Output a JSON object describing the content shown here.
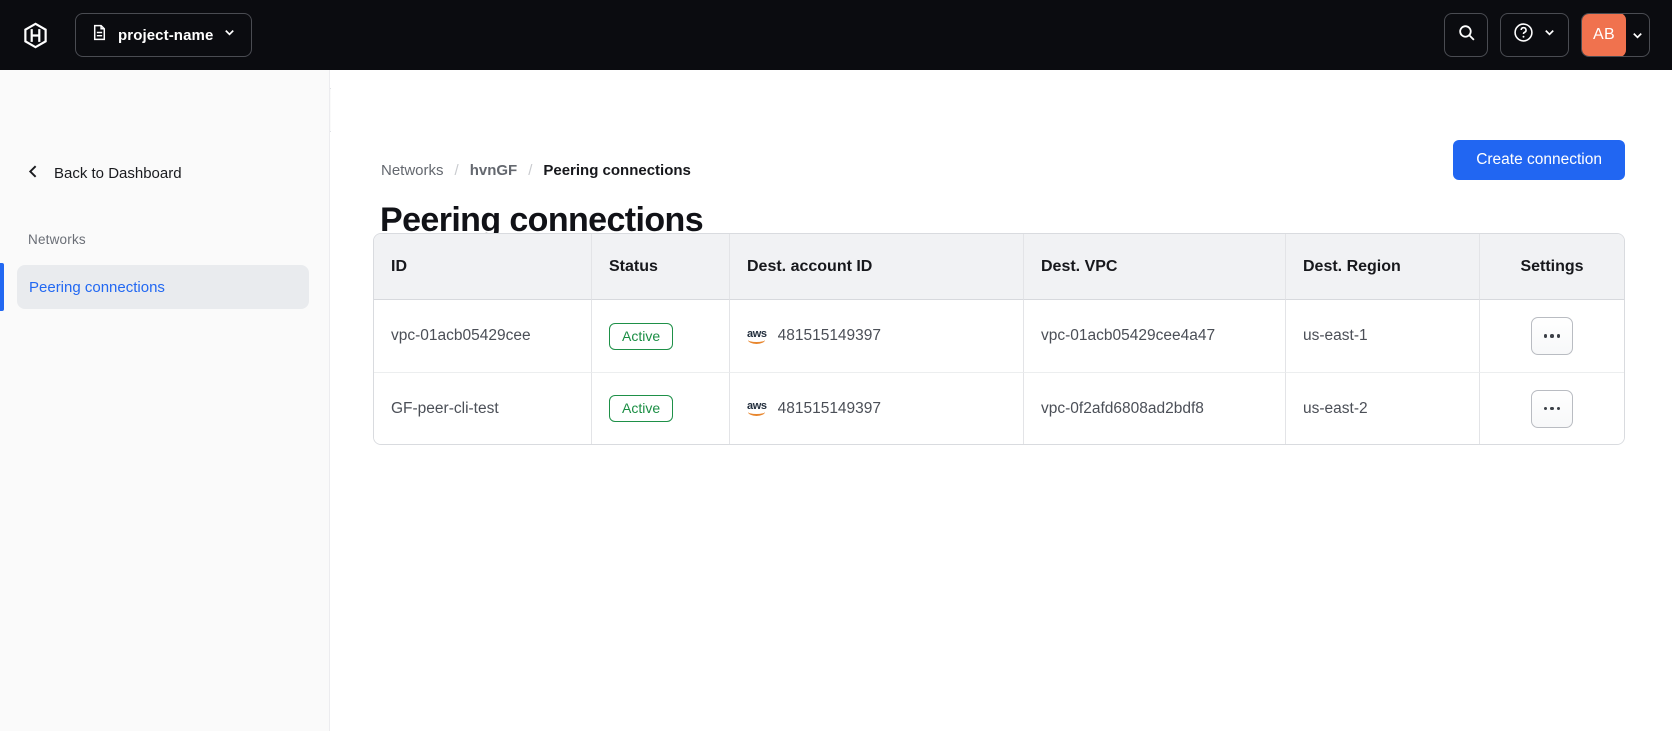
{
  "colors": {
    "topbar_bg": "#0b0c10",
    "accent_blue": "#2166f2",
    "success_green": "#1e9048",
    "avatar_orange": "#f0724e",
    "sidebar_bg": "#fafafa"
  },
  "topbar": {
    "project_switcher": {
      "label": "project-name"
    },
    "account": {
      "initials": "AB"
    }
  },
  "sidebar": {
    "back_label": "Back to Dashboard",
    "section_label": "Networks",
    "items": [
      {
        "label": "Peering connections",
        "active": true
      }
    ]
  },
  "breadcrumb": {
    "separator": "/",
    "items": [
      "Networks",
      "hvnGF",
      "Peering connections"
    ]
  },
  "page": {
    "title": "Peering connections",
    "create_button_label": "Create connection"
  },
  "table": {
    "aws_icon_label": "aws",
    "columns": [
      "ID",
      "Status",
      "Dest. account ID",
      "Dest. VPC",
      "Dest. Region",
      "Settings"
    ],
    "rows": [
      {
        "id": "vpc-01acb05429cee",
        "status": "Active",
        "dest_account_id": "481515149397",
        "dest_vpc": "vpc-01acb05429cee4a47",
        "dest_region": "us-east-1"
      },
      {
        "id": "GF-peer-cli-test",
        "status": "Active",
        "dest_account_id": "481515149397",
        "dest_vpc": "vpc-0f2afd6808ad2bdf8",
        "dest_region": "us-east-2"
      }
    ]
  }
}
